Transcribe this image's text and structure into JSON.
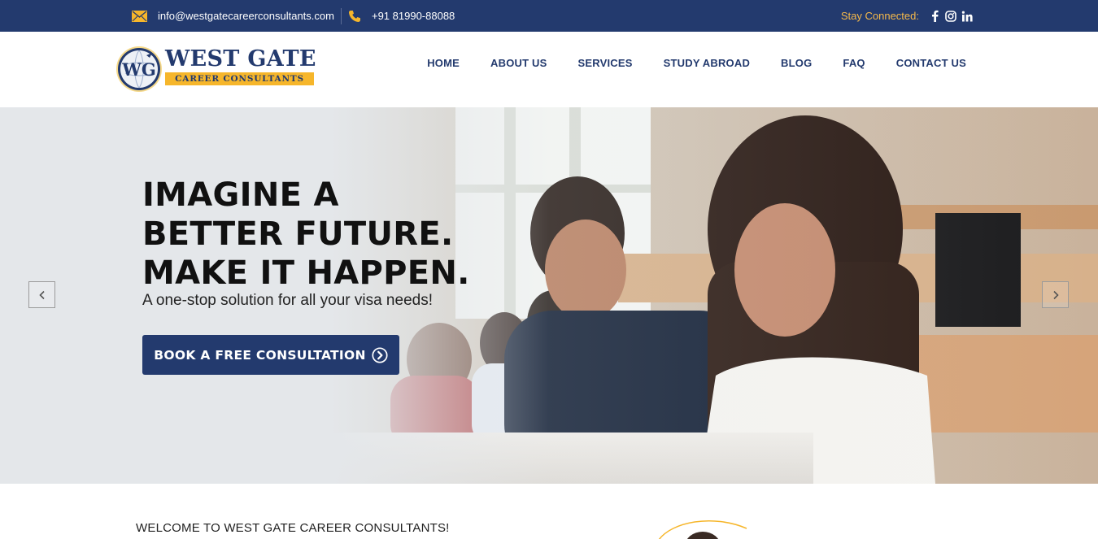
{
  "topbar": {
    "email": "info@westgatecareerconsultants.com",
    "phone": "+91 81990-88088",
    "stay_connected": "Stay Connected:",
    "social_icons": [
      "facebook-icon",
      "instagram-icon",
      "linkedin-icon"
    ]
  },
  "brand": {
    "name": "WEST GATE",
    "tagline": "CAREER CONSULTANTS",
    "monogram": "WG"
  },
  "nav": {
    "items": [
      "HOME",
      "ABOUT US",
      "SERVICES",
      "STUDY ABROAD",
      "BLOG",
      "FAQ",
      "CONTACT US"
    ]
  },
  "hero": {
    "title_lines": [
      "IMAGINE A",
      "BETTER FUTURE.",
      "MAKE IT HAPPEN."
    ],
    "subtitle": "A one-stop solution for all your visa needs!",
    "cta_label": "BOOK A FREE CONSULTATION"
  },
  "welcome": {
    "heading": "WELCOME TO WEST GATE CAREER CONSULTANTS!"
  },
  "colors": {
    "primary": "#233a6e",
    "accent": "#f6b62b",
    "stay_connected": "#f6b94a"
  }
}
